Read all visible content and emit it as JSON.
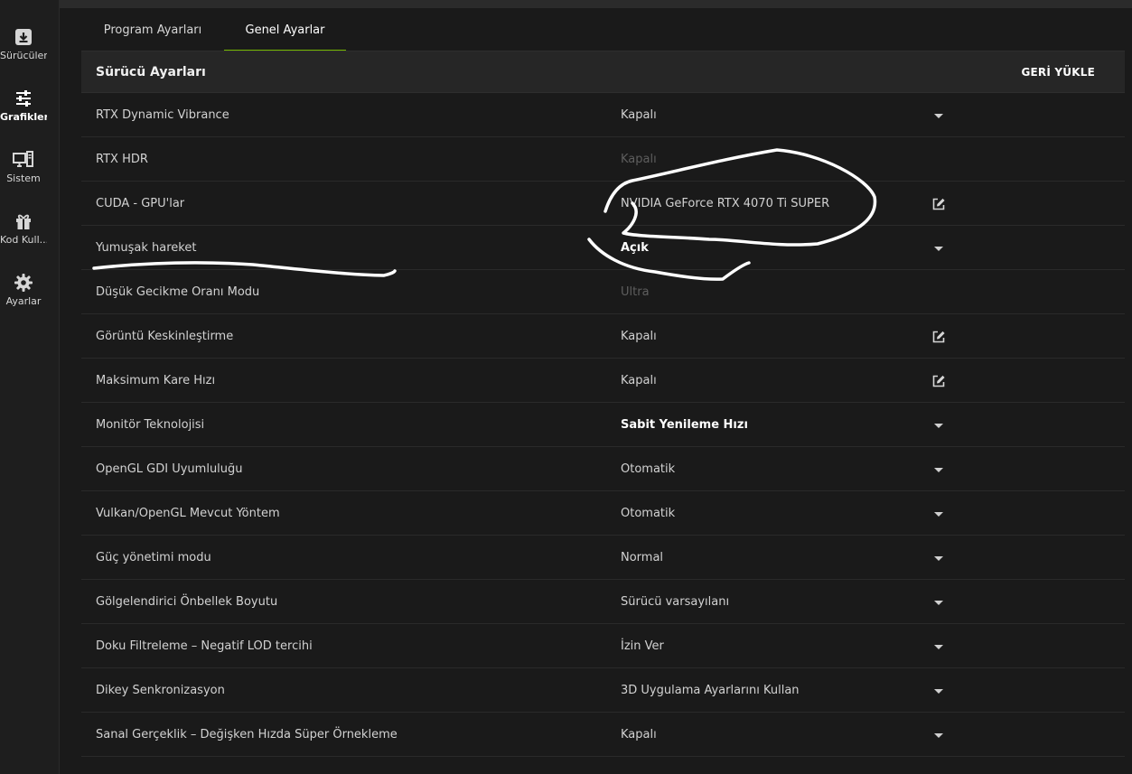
{
  "sidebar": {
    "items": [
      {
        "label": "Sürücüler",
        "icon": "download-icon"
      },
      {
        "label": "Grafikler",
        "icon": "sliders-icon"
      },
      {
        "label": "Sistem",
        "icon": "monitor-icon"
      },
      {
        "label": "Kod Kull...",
        "icon": "gift-icon"
      },
      {
        "label": "Ayarlar",
        "icon": "gear-icon"
      }
    ],
    "active": "Grafikler"
  },
  "tabs": [
    {
      "label": "Program Ayarları"
    },
    {
      "label": "Genel Ayarlar"
    }
  ],
  "active_tab": "Genel Ayarlar",
  "panel": {
    "title": "Sürücü Ayarları",
    "reset_label": "GERİ YÜKLE"
  },
  "settings": [
    {
      "name": "RTX Dynamic Vibrance",
      "value": "Kapalı",
      "control": "dropdown",
      "style": "normal"
    },
    {
      "name": "RTX HDR",
      "value": "Kapalı",
      "control": "none",
      "style": "disabled"
    },
    {
      "name": "CUDA - GPU'lar",
      "value": "NVIDIA GeForce RTX 4070 Ti SUPER",
      "control": "edit",
      "style": "normal"
    },
    {
      "name": "Yumuşak hareket",
      "value": "Açık",
      "control": "dropdown",
      "style": "bold"
    },
    {
      "name": "Düşük Gecikme Oranı Modu",
      "value": "Ultra",
      "control": "none",
      "style": "disabled"
    },
    {
      "name": "Görüntü Keskinleştirme",
      "value": "Kapalı",
      "control": "edit",
      "style": "normal"
    },
    {
      "name": "Maksimum Kare Hızı",
      "value": "Kapalı",
      "control": "edit",
      "style": "normal"
    },
    {
      "name": "Monitör Teknolojisi",
      "value": "Sabit Yenileme Hızı",
      "control": "dropdown",
      "style": "bold"
    },
    {
      "name": "OpenGL GDI Uyumluluğu",
      "value": "Otomatik",
      "control": "dropdown",
      "style": "normal"
    },
    {
      "name": "Vulkan/OpenGL Mevcut Yöntem",
      "value": "Otomatik",
      "control": "dropdown",
      "style": "normal"
    },
    {
      "name": "Güç yönetimi modu",
      "value": "Normal",
      "control": "dropdown",
      "style": "normal"
    },
    {
      "name": "Gölgelendirici Önbellek Boyutu",
      "value": "Sürücü varsayılanı",
      "control": "dropdown",
      "style": "normal"
    },
    {
      "name": "Doku Filtreleme – Negatif LOD tercihi",
      "value": "İzin Ver",
      "control": "dropdown",
      "style": "normal"
    },
    {
      "name": "Dikey Senkronizasyon",
      "value": "3D Uygulama Ayarlarını Kullan",
      "control": "dropdown",
      "style": "normal"
    },
    {
      "name": "Sanal Gerçeklik – Değişken Hızda Süper Örnekleme",
      "value": "Kapalı",
      "control": "dropdown",
      "style": "normal"
    }
  ],
  "colors": {
    "accent": "#76b900",
    "background": "#1a1a1a",
    "header": "#262626",
    "annotation": "#ffffff"
  }
}
